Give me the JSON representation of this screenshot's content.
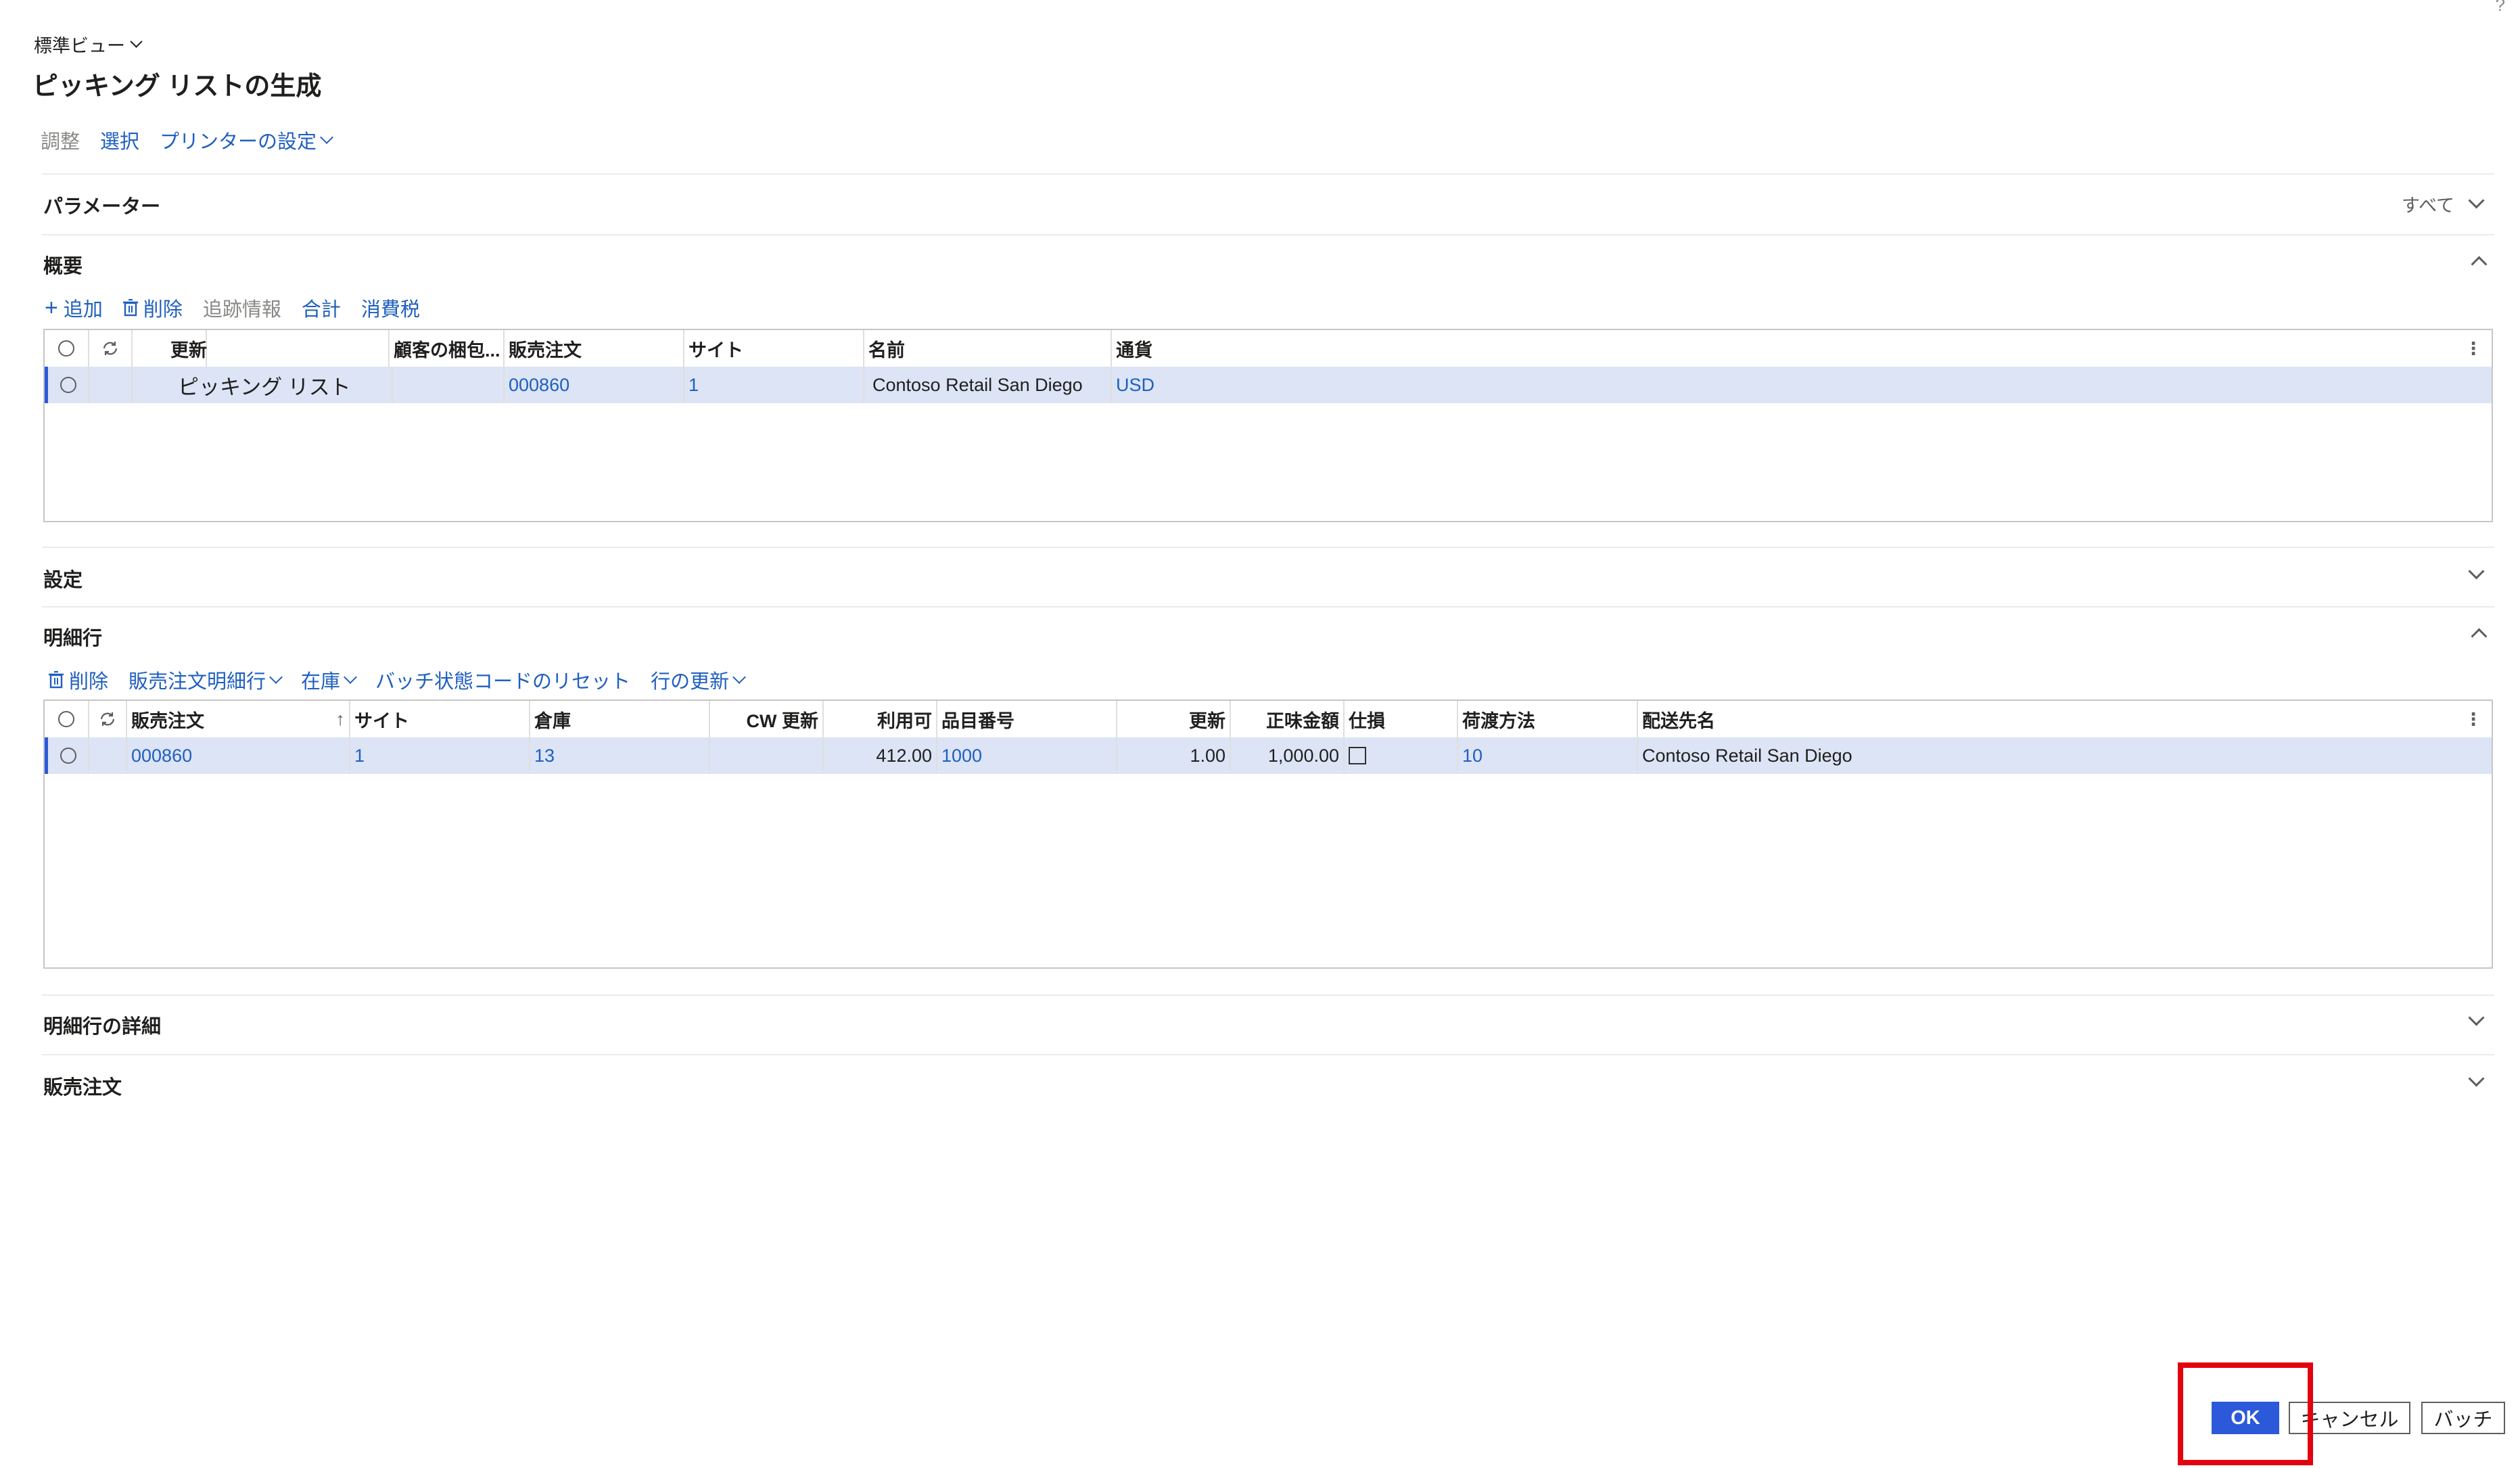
{
  "header": {
    "view_label": "標準ビュー",
    "title": "ピッキング リストの生成",
    "help": "?"
  },
  "action_bar": {
    "adjust": "調整",
    "select": "選択",
    "printer_settings": "プリンターの設定"
  },
  "parameters": {
    "title": "パラメーター",
    "filter_label": "すべて"
  },
  "overview": {
    "title": "概要",
    "toolbar": {
      "add": "追加",
      "delete": "削除",
      "tracking": "追跡情報",
      "total": "合計",
      "tax": "消費税"
    },
    "columns": [
      "更新",
      "顧客の梱包...",
      "販売注文",
      "サイト",
      "名前",
      "通貨"
    ],
    "rows": [
      {
        "update": "ピッキング リスト",
        "customer_pack": "",
        "sales_order": "000860",
        "site": "1",
        "name": "Contoso Retail San Diego",
        "currency": "USD"
      }
    ]
  },
  "settings": {
    "title": "設定"
  },
  "lines": {
    "title": "明細行",
    "toolbar": {
      "delete": "削除",
      "order_lines": "販売注文明細行",
      "inventory": "在庫",
      "reset_batch": "バッチ状態コードのリセット",
      "update_rows": "行の更新"
    },
    "columns": [
      "販売注文",
      "サイト",
      "倉庫",
      "CW 更新",
      "利用可",
      "品目番号",
      "更新",
      "正味金額",
      "仕損",
      "荷渡方法",
      "配送先名"
    ],
    "sort_indicator": "↑",
    "rows": [
      {
        "sales_order": "000860",
        "site": "1",
        "warehouse": "13",
        "cw_update": "",
        "available": "412.00",
        "item_number": "1000",
        "update": "1.00",
        "net_amount": "1,000.00",
        "delivery_mode": "10",
        "ship_to_name": "Contoso Retail San Diego"
      }
    ]
  },
  "line_details": {
    "title": "明細行の詳細"
  },
  "sales_order_section": {
    "title": "販売注文"
  },
  "footer": {
    "ok": "OK",
    "cancel": "キャンセル",
    "batch": "バッチ"
  },
  "colors": {
    "accent": "#2b59d9",
    "link": "#1f5fbf",
    "selected_row": "#dce4f6",
    "highlight": "#e3000f"
  }
}
